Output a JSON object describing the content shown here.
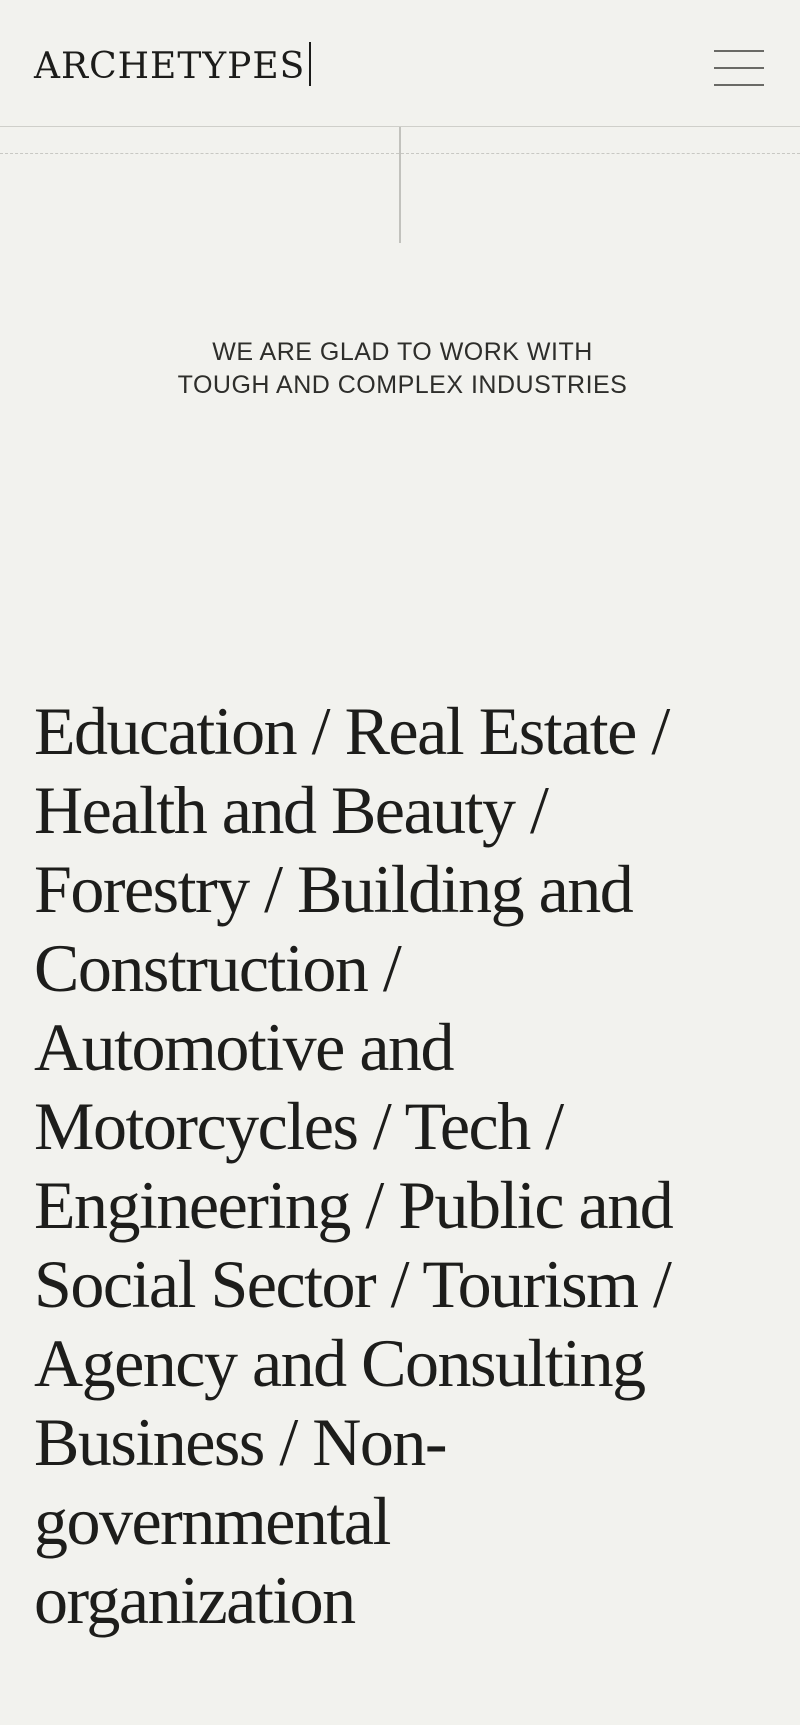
{
  "header": {
    "logo": "ARCHETYPES",
    "menu_icon": "hamburger-menu-icon"
  },
  "intro": {
    "line1": "WE ARE GLAD TO WORK WITH",
    "line2": "TOUGH AND COMPLEX INDUSTRIES"
  },
  "industries": {
    "lines": [
      "Education / Real Estate /",
      "Health and Beauty /",
      "Forestry / Building and",
      "Construction /",
      "Automotive and",
      "Motorcycles / Tech /",
      "Engineering / Public and",
      "Social Sector / Tourism  /",
      "Agency and Consulting",
      "Business / Non-",
      "governmental",
      "organization"
    ]
  },
  "colors": {
    "background": "#f2f2ee",
    "text": "#1d1d1b",
    "lines": "#cfcfca"
  }
}
